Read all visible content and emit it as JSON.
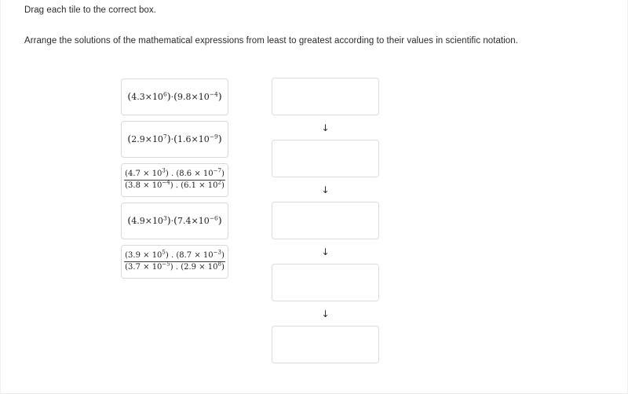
{
  "instructions": {
    "line1": "Drag each tile to the correct box.",
    "line2": "Arrange the solutions of the mathematical expressions from least to greatest according to their values in scientific notation."
  },
  "tiles": [
    {
      "id": "tile-1",
      "type": "product",
      "plain_text": "(4.3×10⁶)·(9.8×10⁻⁴)",
      "factors": [
        {
          "coefficient": "4.3",
          "base": "10",
          "exponent": "6"
        },
        {
          "coefficient": "9.8",
          "base": "10",
          "exponent": "−4"
        }
      ]
    },
    {
      "id": "tile-2",
      "type": "product",
      "plain_text": "(2.9×10⁷)·(1.6×10⁻⁹)",
      "factors": [
        {
          "coefficient": "2.9",
          "base": "10",
          "exponent": "7"
        },
        {
          "coefficient": "1.6",
          "base": "10",
          "exponent": "−9"
        }
      ]
    },
    {
      "id": "tile-3",
      "type": "fraction",
      "plain_text": "[(4.7 x 10^3) . (8.6 x 10^-7)] / [(3.8 x 10^-4) . (6.1 x 10^2)]",
      "numerator": [
        {
          "coefficient": "4.7",
          "base": "10",
          "exponent": "3"
        },
        {
          "coefficient": "8.6",
          "base": "10",
          "exponent": "−7"
        }
      ],
      "denominator": [
        {
          "coefficient": "3.8",
          "base": "10",
          "exponent": "−4"
        },
        {
          "coefficient": "6.1",
          "base": "10",
          "exponent": "2"
        }
      ]
    },
    {
      "id": "tile-4",
      "type": "product",
      "plain_text": "(4.9×10³)·(7.4×10⁻⁶)",
      "factors": [
        {
          "coefficient": "4.9",
          "base": "10",
          "exponent": "3"
        },
        {
          "coefficient": "7.4",
          "base": "10",
          "exponent": "−6"
        }
      ]
    },
    {
      "id": "tile-5",
      "type": "fraction",
      "plain_text": "[(3.9 x 10^5) . (8.7 x 10^-3)] / [(3.7 x 10^-5) . (2.9 x 10^8)]",
      "numerator": [
        {
          "coefficient": "3.9",
          "base": "10",
          "exponent": "5"
        },
        {
          "coefficient": "8.7",
          "base": "10",
          "exponent": "−3"
        }
      ],
      "denominator": [
        {
          "coefficient": "3.7",
          "base": "10",
          "exponent": "−5"
        },
        {
          "coefficient": "2.9",
          "base": "10",
          "exponent": "8"
        }
      ]
    }
  ],
  "drop_boxes": [
    {
      "id": "drop-box-1",
      "value": ""
    },
    {
      "id": "drop-box-2",
      "value": ""
    },
    {
      "id": "drop-box-3",
      "value": ""
    },
    {
      "id": "drop-box-4",
      "value": ""
    },
    {
      "id": "drop-box-5",
      "value": ""
    }
  ],
  "arrows": [
    {
      "glyph": "↓"
    },
    {
      "glyph": "↓"
    },
    {
      "glyph": "↓"
    },
    {
      "glyph": "↓"
    }
  ],
  "symbols": {
    "times": "×",
    "times_spaced": " × ",
    "dot": "·",
    "dot_spaced": " . ",
    "open_paren": "(",
    "close_paren": ")"
  },
  "colors": {
    "page_background": "#ffffff",
    "text": "#2b2b2b",
    "tile_border": "#d9d9d9",
    "drop_box_border": "#dcdcdc",
    "fraction_bar": "#3a3a3a"
  }
}
